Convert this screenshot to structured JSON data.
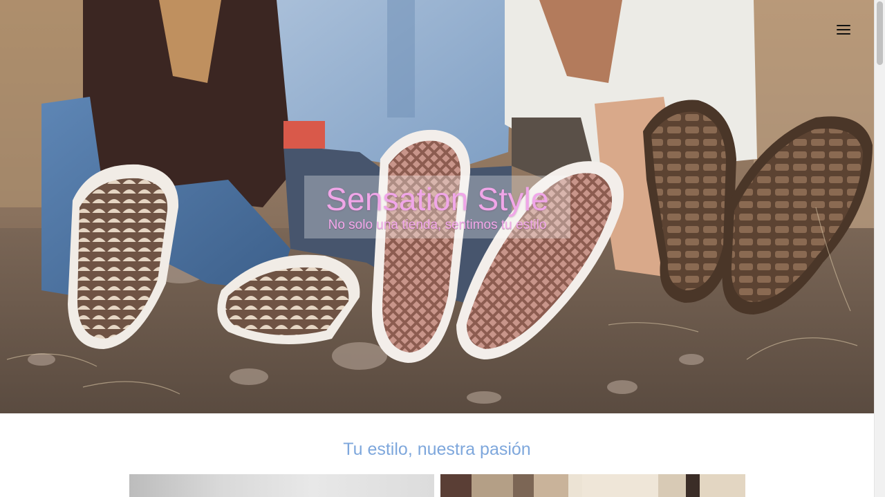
{
  "hero": {
    "title": "Sensation Style",
    "subtitle": "No solo una tienda, sentimos tu estilo",
    "image_description_icon": "photo-girls-sneakers"
  },
  "nav": {
    "menu_icon": "hamburger-menu-icon"
  },
  "section": {
    "heading": "Tu estilo, nuestra pasión"
  },
  "colors": {
    "hero_title": "#f0a6e8",
    "section_heading": "#7ea7dc",
    "caption_background": "rgba(255,255,255,0.30)"
  }
}
